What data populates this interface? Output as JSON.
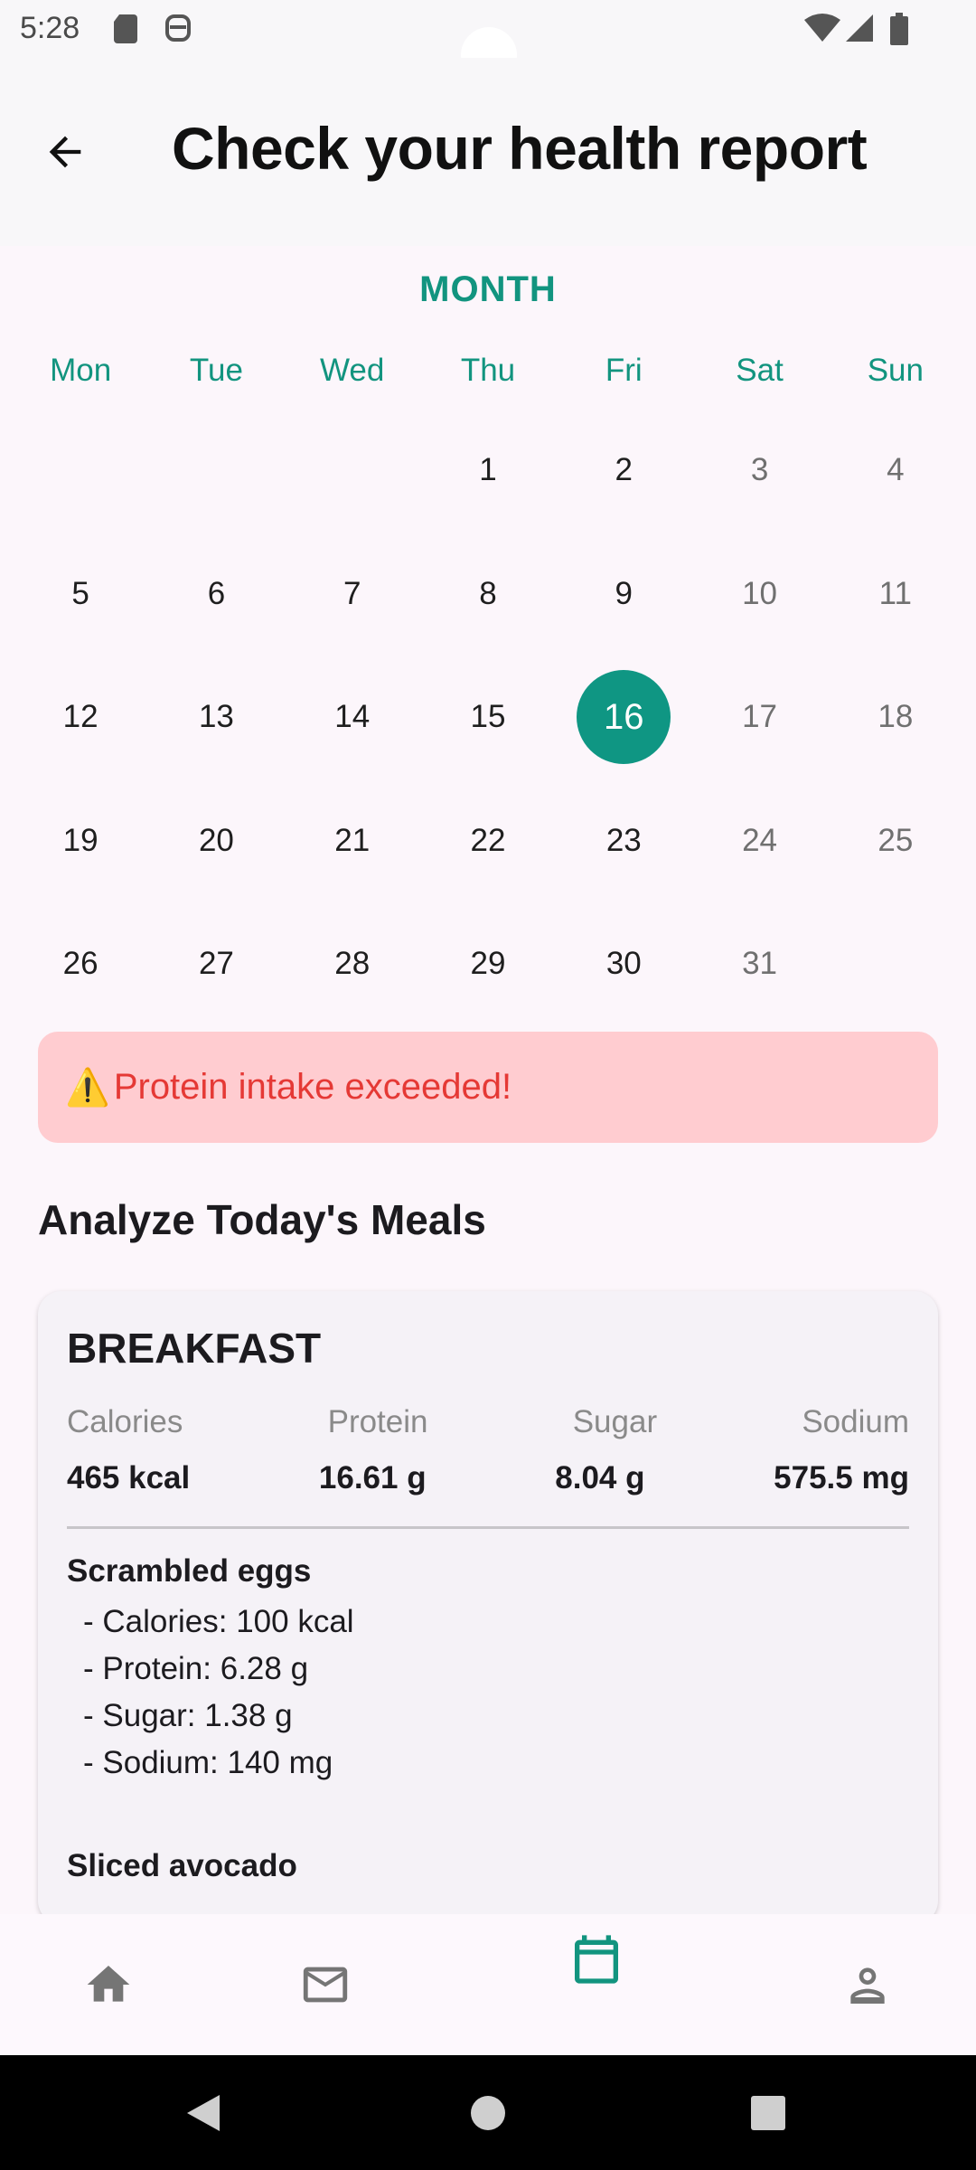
{
  "status_bar": {
    "time": "5:28",
    "left_icons": [
      "sd-card-icon",
      "app-notification-icon"
    ],
    "right_icons": [
      "wifi-icon",
      "signal-icon",
      "battery-icon"
    ]
  },
  "header": {
    "back_icon": "arrow-back-icon",
    "title": "Check your health report"
  },
  "calendar": {
    "month_label": "MONTH",
    "weekdays": [
      "Mon",
      "Tue",
      "Wed",
      "Thu",
      "Fri",
      "Sat",
      "Sun"
    ],
    "leading_blanks": 3,
    "days": [
      "1",
      "2",
      "3",
      "4",
      "5",
      "6",
      "7",
      "8",
      "9",
      "10",
      "11",
      "12",
      "13",
      "14",
      "15",
      "16",
      "17",
      "18",
      "19",
      "20",
      "21",
      "22",
      "23",
      "24",
      "25",
      "26",
      "27",
      "28",
      "29",
      "30",
      "31"
    ],
    "selected_day": "16",
    "accent_color": "#12947f"
  },
  "alert": {
    "icon": "⚠️",
    "text": "Protein intake exceeded!"
  },
  "meals_section": {
    "title": "Analyze Today's Meals"
  },
  "meal_card": {
    "title": "BREAKFAST",
    "nutrients": [
      {
        "label": "Calories",
        "value": "465 kcal"
      },
      {
        "label": "Protein",
        "value": "16.61 g"
      },
      {
        "label": "Sugar",
        "value": "8.04 g"
      },
      {
        "label": "Sodium",
        "value": "575.5 mg"
      }
    ],
    "foods": [
      {
        "name": "Scrambled eggs",
        "lines": [
          "- Calories: 100 kcal",
          "- Protein: 6.28 g",
          "- Sugar: 1.38 g",
          "- Sodium: 140 mg"
        ]
      },
      {
        "name": "Sliced avocado",
        "lines": []
      }
    ]
  },
  "bottom_nav": {
    "items": [
      {
        "icon": "home-icon",
        "active": false
      },
      {
        "icon": "mail-icon",
        "active": false
      },
      {
        "icon": "calendar-icon",
        "active": true
      },
      {
        "icon": "person-icon",
        "active": false
      }
    ]
  },
  "system_nav": {
    "buttons": [
      "back-triangle-icon",
      "home-circle-icon",
      "recents-square-icon"
    ]
  }
}
